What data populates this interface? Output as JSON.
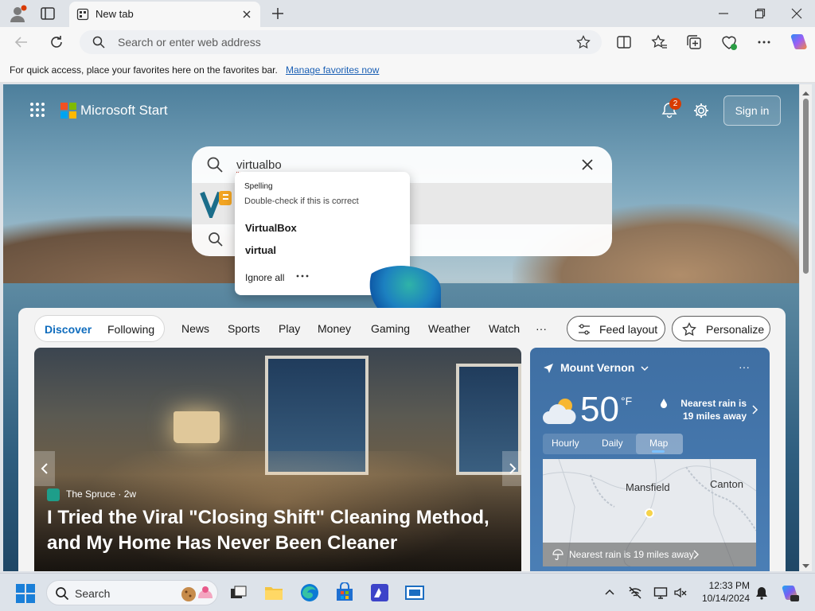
{
  "browser": {
    "tab_title": "New tab",
    "address_placeholder": "Search or enter web address",
    "favorites_message": "For quick access, place your favorites here on the favorites bar.",
    "favorites_link": "Manage favorites now"
  },
  "header": {
    "title": "Microsoft Start",
    "notification_count": "2",
    "signin_label": "Sign in"
  },
  "search": {
    "query": "virtualbo"
  },
  "spell_popup": {
    "heading": "Spelling",
    "subheading": "Double-check if this is correct",
    "suggestions": [
      "VirtualBox",
      "virtual"
    ],
    "ignore_label": "Ignore all",
    "more_label": "···"
  },
  "feed_nav": {
    "discover": "Discover",
    "following": "Following",
    "items": [
      "News",
      "Sports",
      "Play",
      "Money",
      "Gaming",
      "Weather",
      "Watch"
    ],
    "more": "···",
    "feed_layout": "Feed layout",
    "personalize": "Personalize"
  },
  "hero": {
    "source": "The Spruce · 2w",
    "headline": "I Tried the Viral \"Closing Shift\" Cleaning Method, and My Home Has Never Been Cleaner"
  },
  "weather": {
    "location": "Mount Vernon",
    "more": "···",
    "temperature": "50",
    "unit": "°F",
    "rain_note": "Nearest rain is 19 miles away",
    "tabs": [
      "Hourly",
      "Daily",
      "Map"
    ],
    "selected_tab": "Map",
    "map_cities": [
      "Mansfield",
      "Canton"
    ],
    "map_note": "Nearest rain is 19 miles away"
  },
  "taskbar": {
    "search_label": "Search",
    "time": "12:33 PM",
    "date": "10/14/2024"
  },
  "colors": {
    "accent": "#0f6cbd",
    "badge": "#d83b01",
    "weather_panel": "#4b7fb6"
  }
}
